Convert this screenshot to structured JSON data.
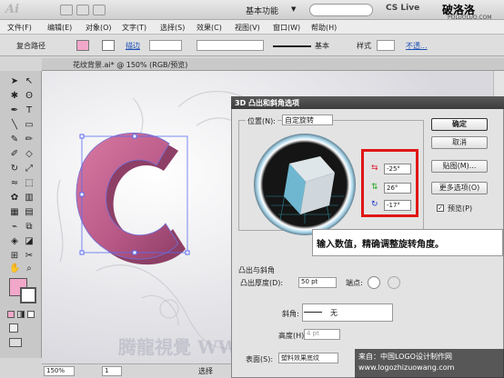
{
  "titlebar": {
    "logo": "Ai",
    "workspace": "基本功能",
    "cs_live": "CS Live",
    "watermark_title": "破洛洛",
    "watermark_url": "POLUOLUO.COM"
  },
  "menubar": [
    "文件(F)",
    "编辑(E)",
    "对象(O)",
    "文字(T)",
    "选择(S)",
    "效果(C)",
    "视图(V)",
    "窗口(W)",
    "帮助(H)"
  ],
  "controlbar": {
    "selection": "复合路径",
    "stroke_label": "描边",
    "stroke_style": "基本",
    "style_label": "样式",
    "opacity_label": "不透..."
  },
  "document": {
    "tab_title": "花纹背景.ai* @ 150% (RGB/预览)"
  },
  "dialog": {
    "title": "3D 凸出和斜角选项",
    "position_label": "位置(N):",
    "position_value": "自定旋转",
    "rotation_x": "-25°",
    "rotation_y": "26°",
    "rotation_z": "-17°",
    "buttons": {
      "ok": "确定",
      "cancel": "取消",
      "map": "贴图(M)...",
      "more": "更多选项(O)",
      "preview": "预览(P)"
    },
    "extrude_section": "凸出与斜角",
    "extrude_depth_label": "凸出厚度(D):",
    "extrude_depth_value": "50 pt",
    "cap_label": "端点:",
    "bevel_label": "斜角:",
    "bevel_value": "无",
    "height_label": "高度(H):",
    "height_value": "4 pt",
    "surface_label": "表面(S):",
    "surface_value": "塑料效果底纹"
  },
  "callout": "输入数值，精确调整旋转角度。",
  "statusbar": {
    "zoom": "150%",
    "page": "1",
    "mode": "选择"
  },
  "footer_watermark": {
    "line1": "来自：中国LOGO设计制作网",
    "line2": "www.logozhizuowang.com"
  },
  "canvas_watermark": "腾龍視覺 WWW.TT"
}
